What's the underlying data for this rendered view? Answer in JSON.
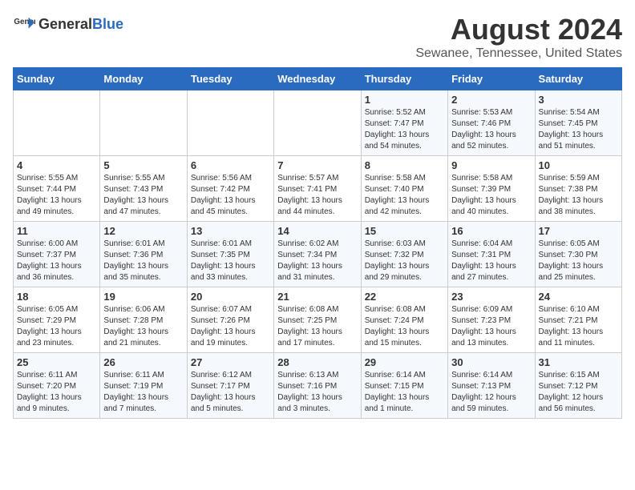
{
  "header": {
    "logo_general": "General",
    "logo_blue": "Blue",
    "title": "August 2024",
    "subtitle": "Sewanee, Tennessee, United States"
  },
  "days_of_week": [
    "Sunday",
    "Monday",
    "Tuesday",
    "Wednesday",
    "Thursday",
    "Friday",
    "Saturday"
  ],
  "weeks": [
    [
      {
        "day": "",
        "content": ""
      },
      {
        "day": "",
        "content": ""
      },
      {
        "day": "",
        "content": ""
      },
      {
        "day": "",
        "content": ""
      },
      {
        "day": "1",
        "content": "Sunrise: 5:52 AM\nSunset: 7:47 PM\nDaylight: 13 hours\nand 54 minutes."
      },
      {
        "day": "2",
        "content": "Sunrise: 5:53 AM\nSunset: 7:46 PM\nDaylight: 13 hours\nand 52 minutes."
      },
      {
        "day": "3",
        "content": "Sunrise: 5:54 AM\nSunset: 7:45 PM\nDaylight: 13 hours\nand 51 minutes."
      }
    ],
    [
      {
        "day": "4",
        "content": "Sunrise: 5:55 AM\nSunset: 7:44 PM\nDaylight: 13 hours\nand 49 minutes."
      },
      {
        "day": "5",
        "content": "Sunrise: 5:55 AM\nSunset: 7:43 PM\nDaylight: 13 hours\nand 47 minutes."
      },
      {
        "day": "6",
        "content": "Sunrise: 5:56 AM\nSunset: 7:42 PM\nDaylight: 13 hours\nand 45 minutes."
      },
      {
        "day": "7",
        "content": "Sunrise: 5:57 AM\nSunset: 7:41 PM\nDaylight: 13 hours\nand 44 minutes."
      },
      {
        "day": "8",
        "content": "Sunrise: 5:58 AM\nSunset: 7:40 PM\nDaylight: 13 hours\nand 42 minutes."
      },
      {
        "day": "9",
        "content": "Sunrise: 5:58 AM\nSunset: 7:39 PM\nDaylight: 13 hours\nand 40 minutes."
      },
      {
        "day": "10",
        "content": "Sunrise: 5:59 AM\nSunset: 7:38 PM\nDaylight: 13 hours\nand 38 minutes."
      }
    ],
    [
      {
        "day": "11",
        "content": "Sunrise: 6:00 AM\nSunset: 7:37 PM\nDaylight: 13 hours\nand 36 minutes."
      },
      {
        "day": "12",
        "content": "Sunrise: 6:01 AM\nSunset: 7:36 PM\nDaylight: 13 hours\nand 35 minutes."
      },
      {
        "day": "13",
        "content": "Sunrise: 6:01 AM\nSunset: 7:35 PM\nDaylight: 13 hours\nand 33 minutes."
      },
      {
        "day": "14",
        "content": "Sunrise: 6:02 AM\nSunset: 7:34 PM\nDaylight: 13 hours\nand 31 minutes."
      },
      {
        "day": "15",
        "content": "Sunrise: 6:03 AM\nSunset: 7:32 PM\nDaylight: 13 hours\nand 29 minutes."
      },
      {
        "day": "16",
        "content": "Sunrise: 6:04 AM\nSunset: 7:31 PM\nDaylight: 13 hours\nand 27 minutes."
      },
      {
        "day": "17",
        "content": "Sunrise: 6:05 AM\nSunset: 7:30 PM\nDaylight: 13 hours\nand 25 minutes."
      }
    ],
    [
      {
        "day": "18",
        "content": "Sunrise: 6:05 AM\nSunset: 7:29 PM\nDaylight: 13 hours\nand 23 minutes."
      },
      {
        "day": "19",
        "content": "Sunrise: 6:06 AM\nSunset: 7:28 PM\nDaylight: 13 hours\nand 21 minutes."
      },
      {
        "day": "20",
        "content": "Sunrise: 6:07 AM\nSunset: 7:26 PM\nDaylight: 13 hours\nand 19 minutes."
      },
      {
        "day": "21",
        "content": "Sunrise: 6:08 AM\nSunset: 7:25 PM\nDaylight: 13 hours\nand 17 minutes."
      },
      {
        "day": "22",
        "content": "Sunrise: 6:08 AM\nSunset: 7:24 PM\nDaylight: 13 hours\nand 15 minutes."
      },
      {
        "day": "23",
        "content": "Sunrise: 6:09 AM\nSunset: 7:23 PM\nDaylight: 13 hours\nand 13 minutes."
      },
      {
        "day": "24",
        "content": "Sunrise: 6:10 AM\nSunset: 7:21 PM\nDaylight: 13 hours\nand 11 minutes."
      }
    ],
    [
      {
        "day": "25",
        "content": "Sunrise: 6:11 AM\nSunset: 7:20 PM\nDaylight: 13 hours\nand 9 minutes."
      },
      {
        "day": "26",
        "content": "Sunrise: 6:11 AM\nSunset: 7:19 PM\nDaylight: 13 hours\nand 7 minutes."
      },
      {
        "day": "27",
        "content": "Sunrise: 6:12 AM\nSunset: 7:17 PM\nDaylight: 13 hours\nand 5 minutes."
      },
      {
        "day": "28",
        "content": "Sunrise: 6:13 AM\nSunset: 7:16 PM\nDaylight: 13 hours\nand 3 minutes."
      },
      {
        "day": "29",
        "content": "Sunrise: 6:14 AM\nSunset: 7:15 PM\nDaylight: 13 hours\nand 1 minute."
      },
      {
        "day": "30",
        "content": "Sunrise: 6:14 AM\nSunset: 7:13 PM\nDaylight: 12 hours\nand 59 minutes."
      },
      {
        "day": "31",
        "content": "Sunrise: 6:15 AM\nSunset: 7:12 PM\nDaylight: 12 hours\nand 56 minutes."
      }
    ]
  ]
}
